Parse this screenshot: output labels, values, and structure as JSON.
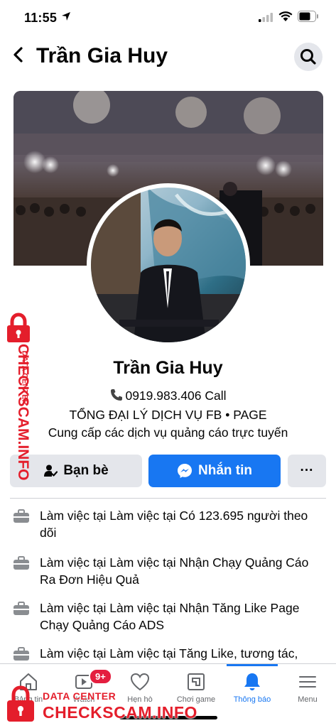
{
  "status_bar": {
    "time": "11:55"
  },
  "header": {
    "title": "Trần Gia Huy"
  },
  "profile": {
    "name": "Trần Gia Huy",
    "phone_line": "0919.983.406 Call",
    "bio_line2": "TỔNG ĐẠI LÝ DỊCH VỤ FB • PAGE",
    "bio_line3": "Cung cấp các dịch vụ quảng cáo trực tuyến"
  },
  "actions": {
    "friends_label": "Bạn bè",
    "message_label": "Nhắn tin",
    "more_label": "···"
  },
  "work": [
    {
      "text": "Làm việc tại Làm việc tại Có 123.695 người theo dõi"
    },
    {
      "text": "Làm việc tại Làm việc tại Nhận Chạy Quảng Cáo Ra Đơn Hiệu Quả"
    },
    {
      "text": "Làm việc tại Làm việc tại Nhận Tăng Like Page Chạy Quảng Cáo ADS"
    },
    {
      "text": "Làm việc tại Làm việc tại Tăng Like, tương tác,"
    }
  ],
  "bottom_nav": {
    "items": [
      {
        "label": "Bảng tin",
        "icon": "home-icon"
      },
      {
        "label": "Watch",
        "icon": "watch-icon",
        "badge": "9+"
      },
      {
        "label": "Hẹn hò",
        "icon": "dating-icon"
      },
      {
        "label": "Chơi game",
        "icon": "gaming-icon"
      },
      {
        "label": "Thông báo",
        "icon": "bell-icon"
      },
      {
        "label": "Menu",
        "icon": "menu-icon"
      }
    ]
  },
  "watermark": {
    "small": "DATA CENTER",
    "big": "CHECKSCAM.INFO"
  },
  "colors": {
    "accent": "#1877f2",
    "watermark": "#e41e2b"
  }
}
